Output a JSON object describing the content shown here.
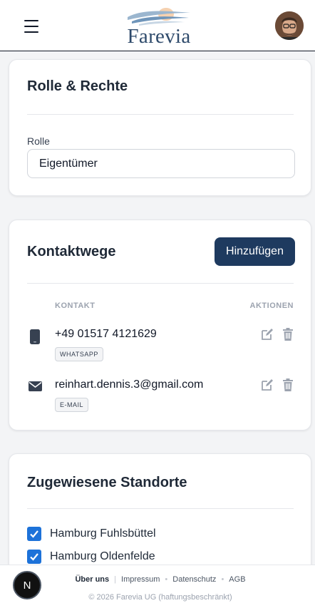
{
  "header": {
    "brand": "Farevia",
    "brand_color": "#2e4a6b"
  },
  "role_card": {
    "title": "Rolle & Rechte",
    "field_label": "Rolle",
    "selected_value": "Eigentümer"
  },
  "contacts_card": {
    "title": "Kontaktwege",
    "add_button": "Hinzufügen",
    "col_contact": "KONTAKT",
    "col_actions": "AKTIONEN",
    "items": [
      {
        "value": "+49 01517 4121629",
        "type": "WHATSAPP",
        "icon": "phone-icon"
      },
      {
        "value": "reinhart.dennis.3@gmail.com",
        "type": "E-MAIL",
        "icon": "mail-icon"
      }
    ]
  },
  "locations_card": {
    "title": "Zugewiesene Standorte",
    "items": [
      {
        "label": "Hamburg Fuhlsbüttel",
        "checked": true
      },
      {
        "label": "Hamburg Oldenfelde",
        "checked": true
      }
    ]
  },
  "footer": {
    "links": [
      "Über uns",
      "Impressum",
      "Datenschutz",
      "AGB"
    ],
    "copyright": "© 2026 Farevia UG (haftungsbeschränkt)"
  },
  "fab": {
    "label": "N"
  },
  "colors": {
    "primary_button": "#1e3a5f",
    "checkbox": "#1d72d9",
    "background": "#f3f4f6"
  }
}
